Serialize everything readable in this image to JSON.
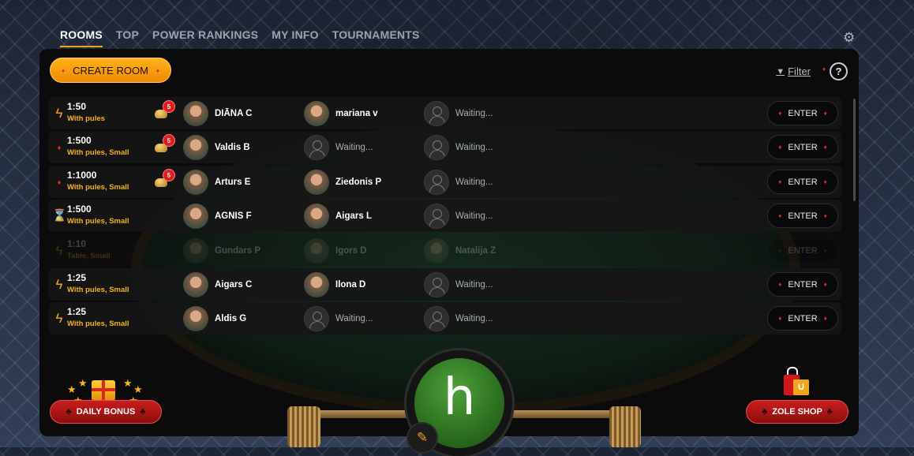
{
  "nav": {
    "tabs": [
      {
        "label": "ROOMS",
        "active": true
      },
      {
        "label": "TOP"
      },
      {
        "label": "POWER RANKINGS"
      },
      {
        "label": "MY INFO"
      },
      {
        "label": "TOURNAMENTS"
      }
    ]
  },
  "toolbar": {
    "create_room_label": "CREATE ROOM",
    "filter_label": "Filter",
    "help_label": "?"
  },
  "rooms": [
    {
      "icon": "lightning-icon",
      "bet": "1:50",
      "subtitle": "With pules",
      "pules": "5",
      "players": [
        "DIĀNA C",
        "mariana v",
        "Waiting..."
      ],
      "enter": "ENTER",
      "disabled": false
    },
    {
      "icon": "diamond-icon",
      "bet": "1:500",
      "subtitle": "With pules, Small",
      "pules": "5",
      "players": [
        "Valdis B",
        "Waiting...",
        "Waiting..."
      ],
      "enter": "ENTER",
      "disabled": false
    },
    {
      "icon": "diamond-icon",
      "bet": "1:1000",
      "subtitle": "With pules, Small",
      "pules": "5",
      "players": [
        "Arturs E",
        "Ziedonis P",
        "Waiting..."
      ],
      "enter": "ENTER",
      "disabled": false
    },
    {
      "icon": "hourglass-icon",
      "bet": "1:500",
      "subtitle": "With pules, Small",
      "pules": "",
      "players": [
        "AGNIS F",
        "Aigars L",
        "Waiting..."
      ],
      "enter": "ENTER",
      "disabled": false
    },
    {
      "icon": "lightning-icon",
      "bet": "1:10",
      "subtitle": "Table, Small",
      "pules": "",
      "players": [
        "Gundars P",
        "Igors D",
        "Natalija Z"
      ],
      "enter": "ENTER",
      "disabled": true
    },
    {
      "icon": "lightning-icon",
      "bet": "1:25",
      "subtitle": "With pules, Small",
      "pules": "",
      "players": [
        "Aigars C",
        "Ilona D",
        "Waiting..."
      ],
      "enter": "ENTER",
      "disabled": false
    },
    {
      "icon": "lightning-icon",
      "bet": "1:25",
      "subtitle": "With pules, Small",
      "pules": "",
      "players": [
        "Aldis G",
        "Waiting...",
        "Waiting..."
      ],
      "enter": "ENTER",
      "disabled": false
    }
  ],
  "bottom": {
    "daily_bonus_label": "DAILY BONUS",
    "shop_label": "ZOLE SHOP",
    "center_letter": "h"
  },
  "colors": {
    "accent": "#f3a21b",
    "danger": "#e21b1b",
    "subtitle": "#f3b21f"
  }
}
